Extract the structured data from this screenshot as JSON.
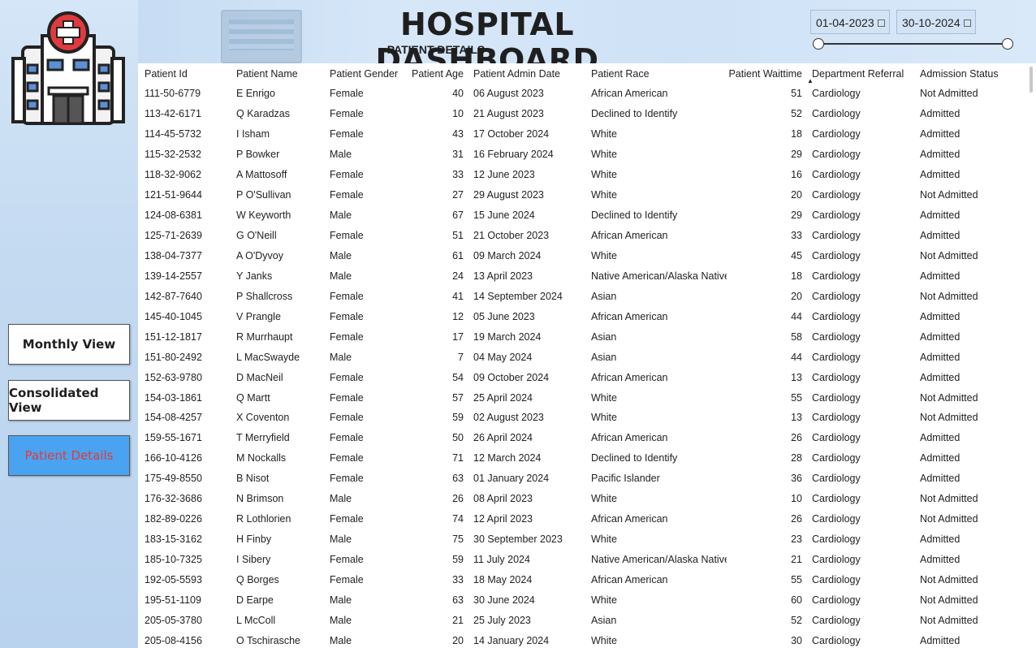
{
  "header": {
    "title": "HOSPITAL DASHBOARD",
    "subtitle": "PATIENT DETAILS"
  },
  "date_slicer": {
    "start": "01-04-2023",
    "end": "30-10-2024"
  },
  "nav": {
    "monthly": "Monthly View",
    "consolidated": "Consolidated View",
    "patient_details": "Patient Details"
  },
  "colors": {
    "active_button_bg": "#4aa3f0",
    "active_button_text": "#e23a3a",
    "logo_red": "#e03a3e"
  },
  "table": {
    "columns": [
      "Patient Id",
      "Patient Name",
      "Patient Gender",
      "Patient Age",
      "Patient Admin Date",
      "Patient Race",
      "Patient Waittime",
      "Department Referral",
      "Admission Status"
    ],
    "sorted_column": "Department Referral",
    "rows": [
      [
        "111-50-6779",
        "E Enrigo",
        "Female",
        "40",
        "06 August 2023",
        "African American",
        "51",
        "Cardiology",
        "Not Admitted"
      ],
      [
        "113-42-6171",
        "Q Karadzas",
        "Female",
        "10",
        "21 August 2023",
        "Declined to Identify",
        "52",
        "Cardiology",
        "Admitted"
      ],
      [
        "114-45-5732",
        "I Isham",
        "Female",
        "43",
        "17 October 2024",
        "White",
        "18",
        "Cardiology",
        "Admitted"
      ],
      [
        "115-32-2532",
        "P Bowker",
        "Male",
        "31",
        "16 February 2024",
        "White",
        "29",
        "Cardiology",
        "Admitted"
      ],
      [
        "118-32-9062",
        "A Mattosoff",
        "Female",
        "33",
        "12 June 2023",
        "White",
        "16",
        "Cardiology",
        "Admitted"
      ],
      [
        "121-51-9644",
        "P O'Sullivan",
        "Female",
        "27",
        "29 August 2023",
        "White",
        "20",
        "Cardiology",
        "Not Admitted"
      ],
      [
        "124-08-6381",
        "W Keyworth",
        "Male",
        "67",
        "15 June 2024",
        "Declined to Identify",
        "29",
        "Cardiology",
        "Admitted"
      ],
      [
        "125-71-2639",
        "G O'Neill",
        "Female",
        "51",
        "21 October 2023",
        "African American",
        "33",
        "Cardiology",
        "Admitted"
      ],
      [
        "138-04-7377",
        "A O'Dyvoy",
        "Male",
        "61",
        "09 March 2024",
        "White",
        "45",
        "Cardiology",
        "Not Admitted"
      ],
      [
        "139-14-2557",
        "Y Janks",
        "Male",
        "24",
        "13 April 2023",
        "Native American/Alaska Native",
        "18",
        "Cardiology",
        "Admitted"
      ],
      [
        "142-87-7640",
        "P Shallcross",
        "Female",
        "41",
        "14 September 2024",
        "Asian",
        "20",
        "Cardiology",
        "Not Admitted"
      ],
      [
        "145-40-1045",
        "V Prangle",
        "Female",
        "12",
        "05 June 2023",
        "African American",
        "44",
        "Cardiology",
        "Admitted"
      ],
      [
        "151-12-1817",
        "R Murrhaupt",
        "Female",
        "17",
        "19 March 2024",
        "Asian",
        "58",
        "Cardiology",
        "Admitted"
      ],
      [
        "151-80-2492",
        "L MacSwayde",
        "Male",
        "7",
        "04 May 2024",
        "Asian",
        "44",
        "Cardiology",
        "Admitted"
      ],
      [
        "152-63-9780",
        "D MacNeil",
        "Female",
        "54",
        "09 October 2024",
        "African American",
        "13",
        "Cardiology",
        "Admitted"
      ],
      [
        "154-03-1861",
        "Q Martt",
        "Female",
        "57",
        "25 April 2024",
        "White",
        "55",
        "Cardiology",
        "Not Admitted"
      ],
      [
        "154-08-4257",
        "X Coventon",
        "Female",
        "59",
        "02 August 2023",
        "White",
        "13",
        "Cardiology",
        "Not Admitted"
      ],
      [
        "159-55-1671",
        "T Merryfield",
        "Female",
        "50",
        "26 April 2024",
        "African American",
        "26",
        "Cardiology",
        "Admitted"
      ],
      [
        "166-10-4126",
        "M Nockalls",
        "Female",
        "71",
        "12 March 2024",
        "Declined to Identify",
        "28",
        "Cardiology",
        "Admitted"
      ],
      [
        "175-49-8550",
        "B Nisot",
        "Female",
        "63",
        "01 January 2024",
        "Pacific Islander",
        "36",
        "Cardiology",
        "Admitted"
      ],
      [
        "176-32-3686",
        "N Brimson",
        "Male",
        "26",
        "08 April 2023",
        "White",
        "10",
        "Cardiology",
        "Not Admitted"
      ],
      [
        "182-89-0226",
        "R Lothlorien",
        "Female",
        "74",
        "12 April 2023",
        "African American",
        "26",
        "Cardiology",
        "Not Admitted"
      ],
      [
        "183-15-3162",
        "H Finby",
        "Male",
        "75",
        "30 September 2023",
        "White",
        "23",
        "Cardiology",
        "Admitted"
      ],
      [
        "185-10-7325",
        "I Sibery",
        "Female",
        "59",
        "11 July 2024",
        "Native American/Alaska Native",
        "21",
        "Cardiology",
        "Admitted"
      ],
      [
        "192-05-5593",
        "Q Borges",
        "Female",
        "33",
        "18 May 2024",
        "African American",
        "55",
        "Cardiology",
        "Not Admitted"
      ],
      [
        "195-51-1109",
        "D Earpe",
        "Male",
        "63",
        "30 June 2024",
        "White",
        "60",
        "Cardiology",
        "Not Admitted"
      ],
      [
        "205-05-3780",
        "L McColl",
        "Male",
        "21",
        "25 July 2023",
        "Asian",
        "52",
        "Cardiology",
        "Not Admitted"
      ],
      [
        "205-08-4156",
        "O Tschirasche",
        "Male",
        "20",
        "14 January 2024",
        "White",
        "30",
        "Cardiology",
        "Admitted"
      ]
    ]
  }
}
